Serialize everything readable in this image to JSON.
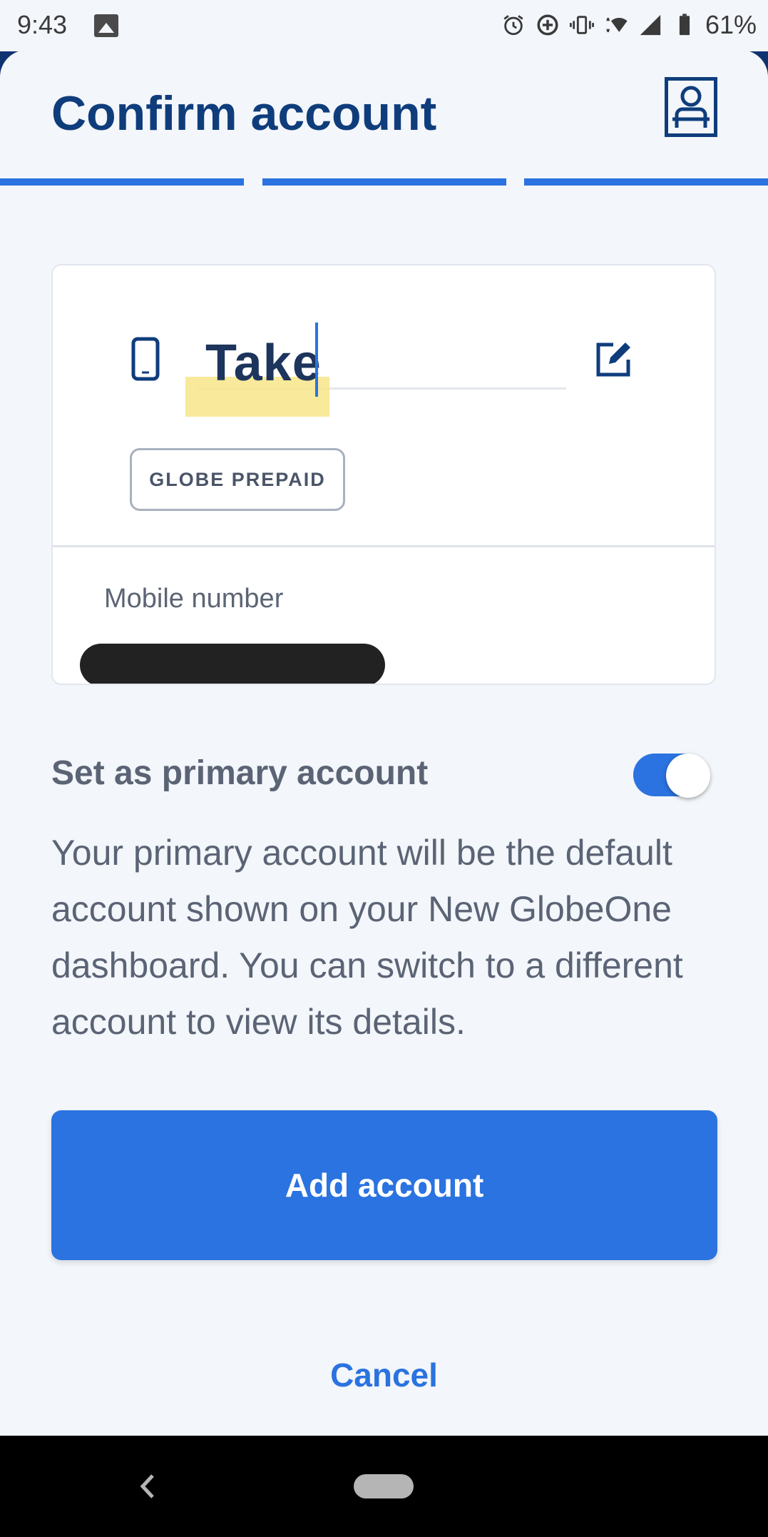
{
  "status_bar": {
    "time": "9:43",
    "battery": "61%",
    "icons": [
      "gallery-icon",
      "alarm-icon",
      "data-saver-icon",
      "vibrate-icon",
      "wifi-icon",
      "signal-icon",
      "battery-icon"
    ]
  },
  "header": {
    "title": "Confirm account",
    "profile_icon": "profile-card-icon"
  },
  "progress": {
    "steps": 3,
    "completed": 3
  },
  "account_card": {
    "name_value": "Take",
    "plan_badge": "GLOBE PREPAID",
    "mobile_label": "Mobile number",
    "phone_icon": "phone-icon",
    "edit_icon": "edit-icon"
  },
  "primary": {
    "label": "Set as primary account",
    "toggle_on": true,
    "description": "Your primary account will be the default account shown on your New GlobeOne dashboard. You can switch to a different account to view its details."
  },
  "actions": {
    "add_label": "Add account",
    "cancel_label": "Cancel"
  },
  "colors": {
    "brand_dark": "#0f3d7c",
    "accent": "#2a73e0",
    "background": "#f3f6fa"
  }
}
